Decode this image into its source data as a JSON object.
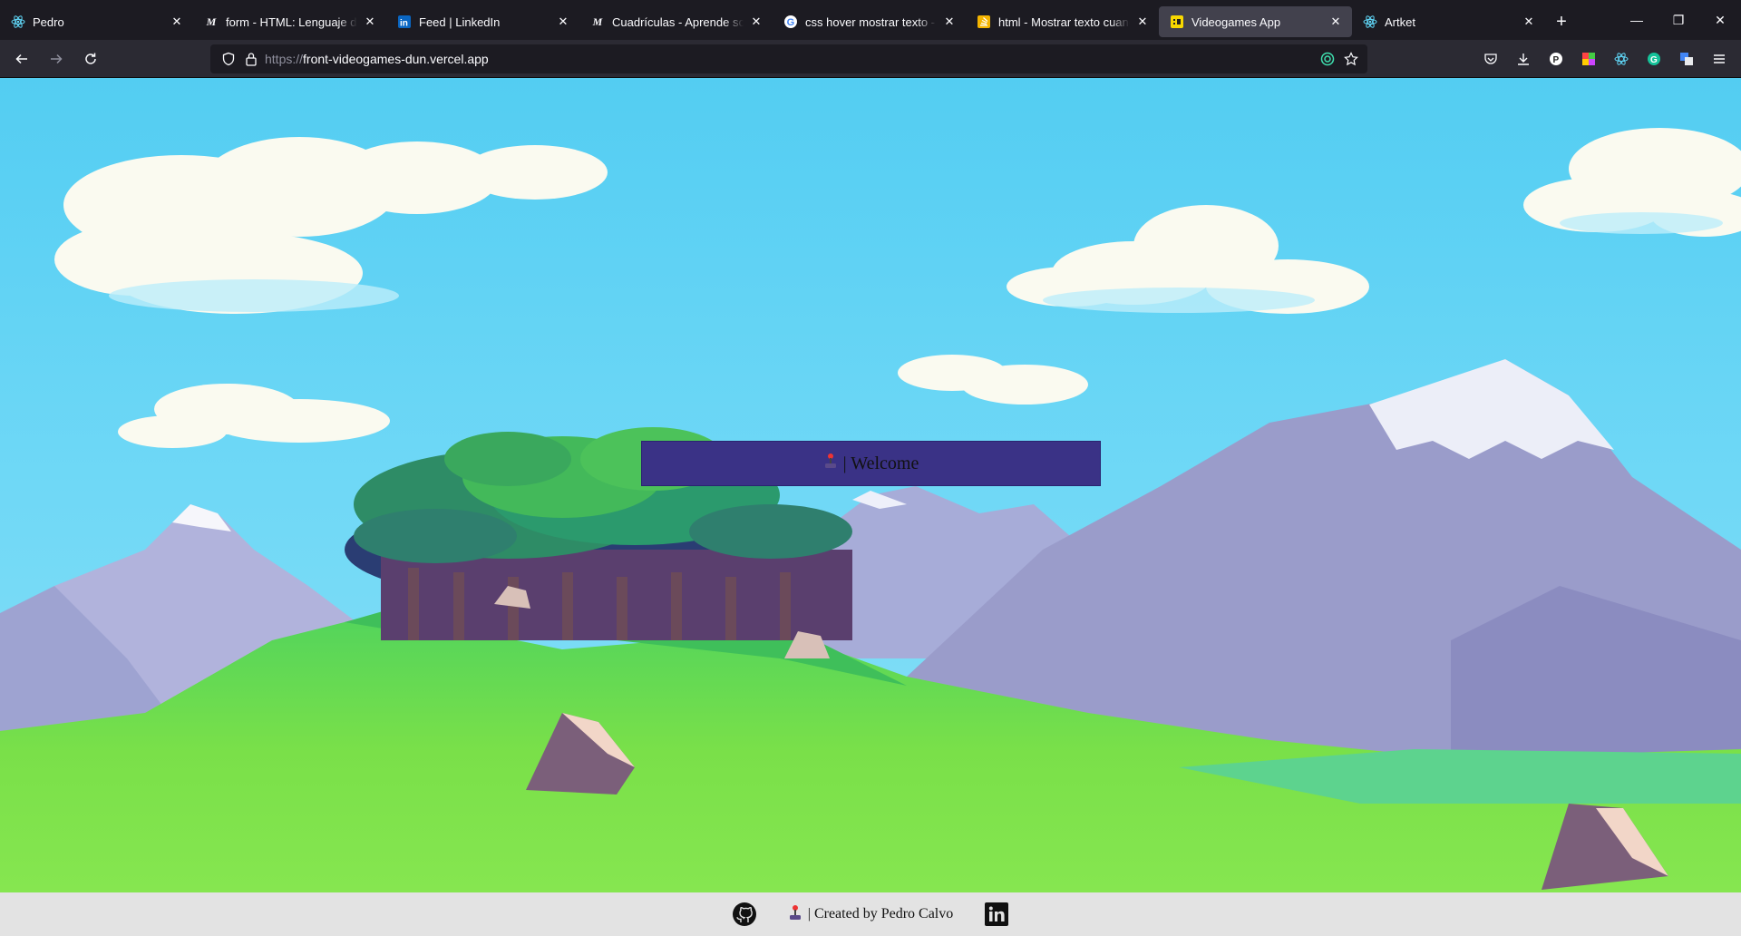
{
  "browser": {
    "tabs": [
      {
        "title": "Pedro",
        "icon": "react-icon"
      },
      {
        "title": "form - HTML: Lenguaje de etiquetas",
        "icon": "mdn-icon"
      },
      {
        "title": "Feed | LinkedIn",
        "icon": "linkedin-icon"
      },
      {
        "title": "Cuadrículas - Aprende sobre",
        "icon": "mdn-icon"
      },
      {
        "title": "css hover mostrar texto - Buscar",
        "icon": "google-icon"
      },
      {
        "title": "html - Mostrar texto cuando",
        "icon": "stackoverflow-icon"
      },
      {
        "title": "Videogames App",
        "icon": "videogames-icon",
        "active": true
      },
      {
        "title": "Artket",
        "icon": "react-icon"
      }
    ],
    "url": {
      "protocol": "https://",
      "host": "front-videogames-dun.vercel.app"
    },
    "colors": {
      "chrome_bg": "#1c1b22",
      "toolbar_bg": "#2b2a33",
      "active_tab": "#42414d"
    }
  },
  "page": {
    "welcome_label": "| Welcome",
    "footer": {
      "credit": "| Created by Pedro Calvo"
    },
    "colors": {
      "button_bg": "#3a3286",
      "footer_bg": "#e3e3e3",
      "sky": "#5ad2f4"
    }
  }
}
